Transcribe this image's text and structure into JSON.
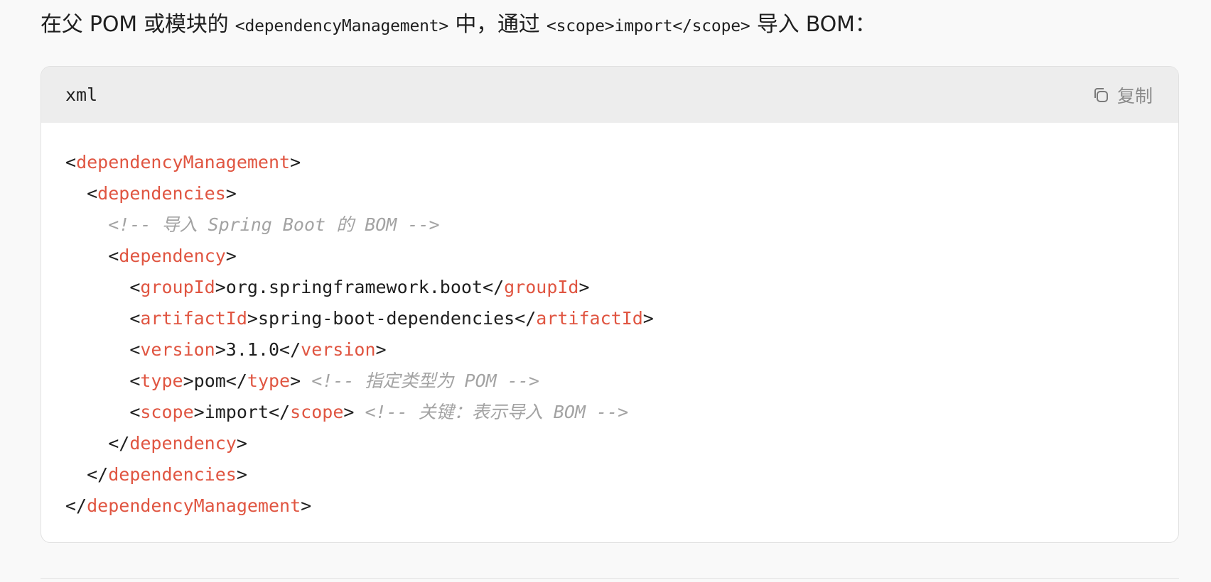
{
  "intro": {
    "t1": "在父 POM 或模块的 ",
    "code1": "<dependencyManagement>",
    "t2": " 中，通过 ",
    "code2": "<scope>import</scope>",
    "t3": " 导入 BOM："
  },
  "code_block": {
    "language": "xml",
    "copy_label": "复制",
    "colors": {
      "tag": "#e05541",
      "comment": "#a3a3a3",
      "header_bg": "#ededed"
    },
    "lines": [
      {
        "indent": "",
        "parts": [
          {
            "t": "<",
            "k": "p"
          },
          {
            "t": "dependencyManagement",
            "k": "tag"
          },
          {
            "t": ">",
            "k": "p"
          }
        ]
      },
      {
        "indent": "  ",
        "parts": [
          {
            "t": "<",
            "k": "p"
          },
          {
            "t": "dependencies",
            "k": "tag"
          },
          {
            "t": ">",
            "k": "p"
          }
        ]
      },
      {
        "indent": "    ",
        "parts": [
          {
            "t": "<!-- 导入 Spring Boot 的 BOM -->",
            "k": "cm"
          }
        ]
      },
      {
        "indent": "    ",
        "parts": [
          {
            "t": "<",
            "k": "p"
          },
          {
            "t": "dependency",
            "k": "tag"
          },
          {
            "t": ">",
            "k": "p"
          }
        ]
      },
      {
        "indent": "      ",
        "parts": [
          {
            "t": "<",
            "k": "p"
          },
          {
            "t": "groupId",
            "k": "tag"
          },
          {
            "t": ">org.springframework.boot</",
            "k": "p"
          },
          {
            "t": "groupId",
            "k": "tag"
          },
          {
            "t": ">",
            "k": "p"
          }
        ]
      },
      {
        "indent": "      ",
        "parts": [
          {
            "t": "<",
            "k": "p"
          },
          {
            "t": "artifactId",
            "k": "tag"
          },
          {
            "t": ">spring-boot-dependencies</",
            "k": "p"
          },
          {
            "t": "artifactId",
            "k": "tag"
          },
          {
            "t": ">",
            "k": "p"
          }
        ]
      },
      {
        "indent": "      ",
        "parts": [
          {
            "t": "<",
            "k": "p"
          },
          {
            "t": "version",
            "k": "tag"
          },
          {
            "t": ">3.1.0</",
            "k": "p"
          },
          {
            "t": "version",
            "k": "tag"
          },
          {
            "t": ">",
            "k": "p"
          }
        ]
      },
      {
        "indent": "      ",
        "parts": [
          {
            "t": "<",
            "k": "p"
          },
          {
            "t": "type",
            "k": "tag"
          },
          {
            "t": ">pom</",
            "k": "p"
          },
          {
            "t": "type",
            "k": "tag"
          },
          {
            "t": "> ",
            "k": "p"
          },
          {
            "t": "<!-- 指定类型为 POM -->",
            "k": "cm"
          }
        ]
      },
      {
        "indent": "      ",
        "parts": [
          {
            "t": "<",
            "k": "p"
          },
          {
            "t": "scope",
            "k": "tag"
          },
          {
            "t": ">import</",
            "k": "p"
          },
          {
            "t": "scope",
            "k": "tag"
          },
          {
            "t": "> ",
            "k": "p"
          },
          {
            "t": "<!-- 关键：表示导入 BOM -->",
            "k": "cm"
          }
        ]
      },
      {
        "indent": "    ",
        "parts": [
          {
            "t": "</",
            "k": "p"
          },
          {
            "t": "dependency",
            "k": "tag"
          },
          {
            "t": ">",
            "k": "p"
          }
        ]
      },
      {
        "indent": "  ",
        "parts": [
          {
            "t": "</",
            "k": "p"
          },
          {
            "t": "dependencies",
            "k": "tag"
          },
          {
            "t": ">",
            "k": "p"
          }
        ]
      },
      {
        "indent": "",
        "parts": [
          {
            "t": "</",
            "k": "p"
          },
          {
            "t": "dependencyManagement",
            "k": "tag"
          },
          {
            "t": ">",
            "k": "p"
          }
        ]
      }
    ]
  }
}
